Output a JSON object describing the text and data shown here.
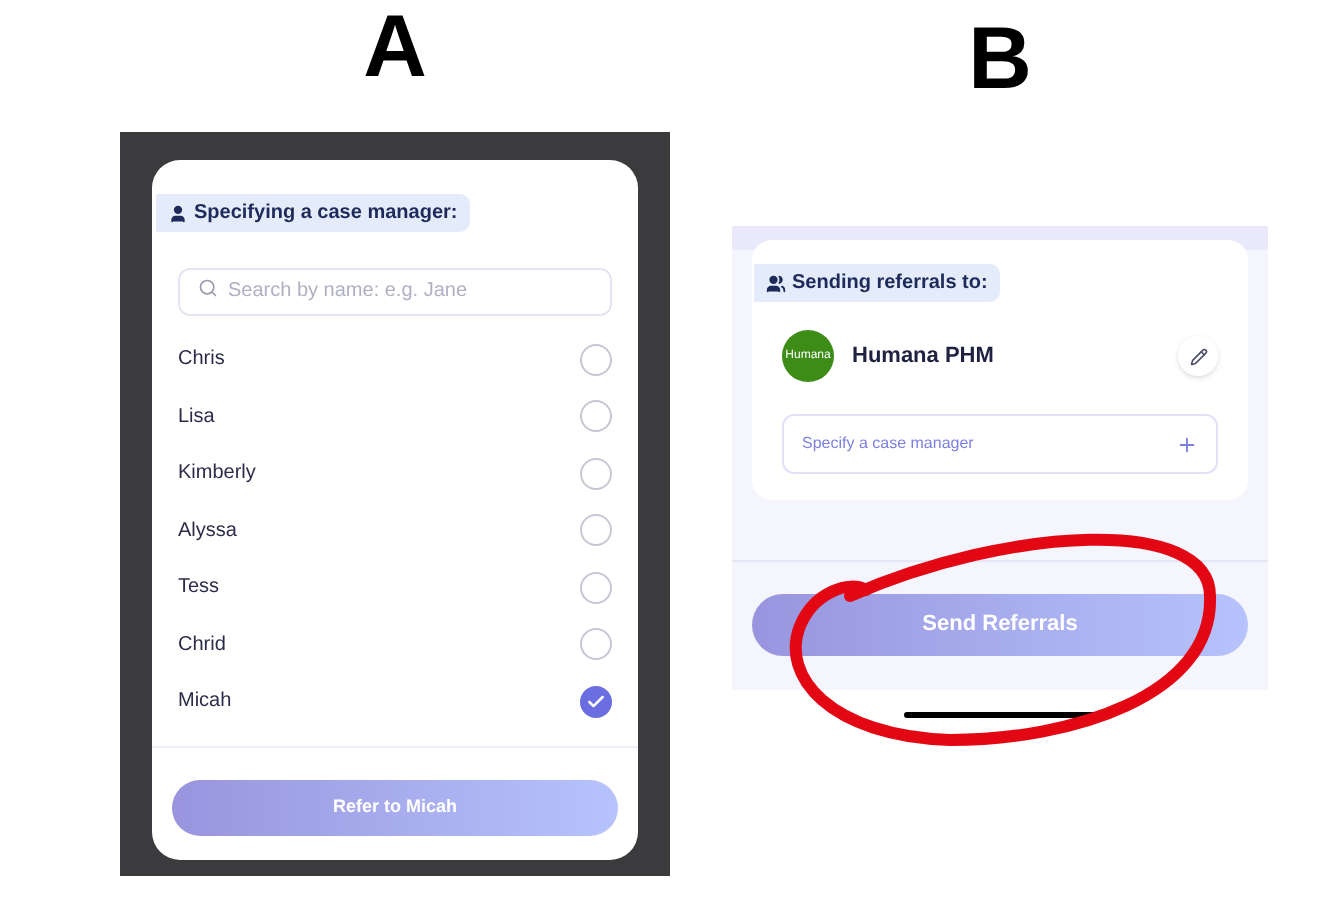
{
  "label_a": "A",
  "label_b": "B",
  "modal": {
    "header": "Specifying a case manager:",
    "search": {
      "placeholder": "Search by name: e.g. Jane"
    },
    "managers": [
      {
        "name": "Chris",
        "selected": false
      },
      {
        "name": "Lisa",
        "selected": false
      },
      {
        "name": "Kimberly",
        "selected": false
      },
      {
        "name": "Alyssa",
        "selected": false
      },
      {
        "name": "Tess",
        "selected": false
      },
      {
        "name": "Chrid",
        "selected": false
      },
      {
        "name": "Micah",
        "selected": true
      }
    ],
    "button": "Refer to Micah"
  },
  "referral": {
    "header": "Sending referrals to:",
    "recipient": {
      "logo": "Humana",
      "name": "Humana PHM"
    },
    "case_manager_button": "Specify a case manager",
    "button": "Send Referrals"
  }
}
